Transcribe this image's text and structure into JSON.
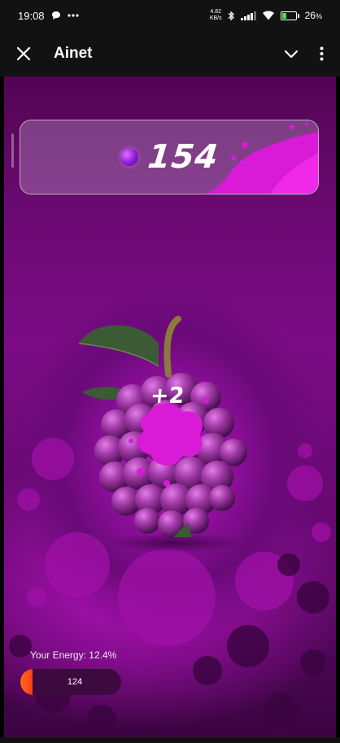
{
  "status_bar": {
    "time": "19:08",
    "net_speed_value": "4.82",
    "net_speed_unit": "KB/s",
    "battery": "26"
  },
  "app_bar": {
    "title": "Ainet",
    "icons": [
      "close-icon",
      "chevron-down-icon",
      "more-vert-icon"
    ]
  },
  "game": {
    "score": "154",
    "tap_reward": "+2",
    "energy_label": "Your Energy: 12.4%",
    "energy_percent": 12.4,
    "energy_value": "124"
  },
  "colors": {
    "accent_magenta": "#d91ad6",
    "energy_orange": "#ff5a1a",
    "background_purple": "#6a0a74"
  }
}
